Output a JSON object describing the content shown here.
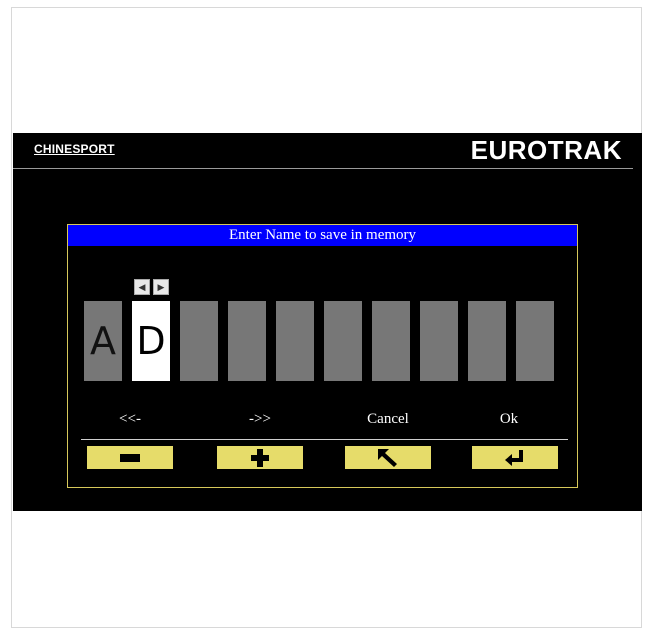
{
  "header": {
    "brand_left": "CHINESPORT",
    "brand_right": "EUROTRAK"
  },
  "dialog": {
    "title": "Enter Name to save in memory",
    "characters": [
      "A",
      "D",
      "",
      "",
      "",
      "",
      "",
      "",
      "",
      ""
    ],
    "active_index": 1
  },
  "actions": [
    {
      "label": "<<-",
      "icon": "minus-icon"
    },
    {
      "label": "->>",
      "icon": "plus-icon"
    },
    {
      "label": "Cancel",
      "icon": "arrow-up-left-icon"
    },
    {
      "label": "Ok",
      "icon": "enter-return-icon"
    }
  ],
  "colors": {
    "title_bar": "#0000ff",
    "button": "#e6dc6a",
    "slot": "#777777",
    "slot_active": "#ffffff"
  }
}
